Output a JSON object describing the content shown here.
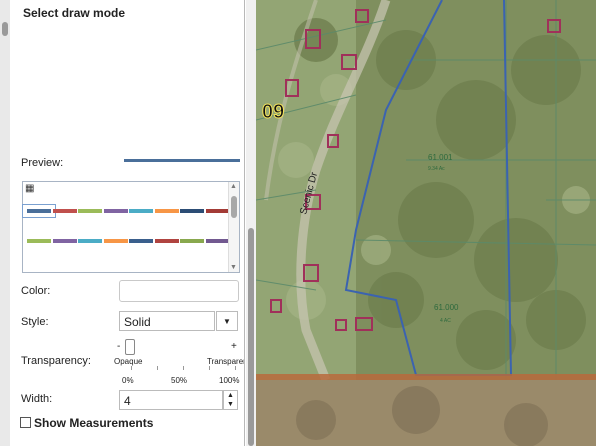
{
  "panel": {
    "title": "Select draw mode",
    "preview_label": "Preview:",
    "preview_color": "#4a6f9a",
    "palette_icon": "grid-icon",
    "palette_row1": [
      "#4a6f9a",
      "#c0504d",
      "#9bbb59",
      "#8064a2",
      "#4bacc6",
      "#f79646",
      "#2c4d75",
      "#a33b36"
    ],
    "palette_row2": [
      "#9bbb59",
      "#8064a2",
      "#4bacc6",
      "#f79646",
      "#3a5f8c",
      "#b04440",
      "#89a84e",
      "#725990"
    ],
    "color_label": "Color:",
    "style_label": "Style:",
    "style_value": "Solid",
    "transparency_label": "Transparency:",
    "slider": {
      "minus": "-",
      "plus": "+",
      "left_label": "Opaque",
      "right_label": "Transparent",
      "ticks": [
        "0%",
        "50%",
        "100%"
      ],
      "value_percent": 0
    },
    "width_label": "Width:",
    "width_value": "4",
    "show_measurements_label": "Show Measurements"
  },
  "map": {
    "parcel_labels": [
      "09",
      "Scenic Dr",
      "61.001",
      "61.000",
      "4 AC",
      "9.34 Ac"
    ]
  }
}
